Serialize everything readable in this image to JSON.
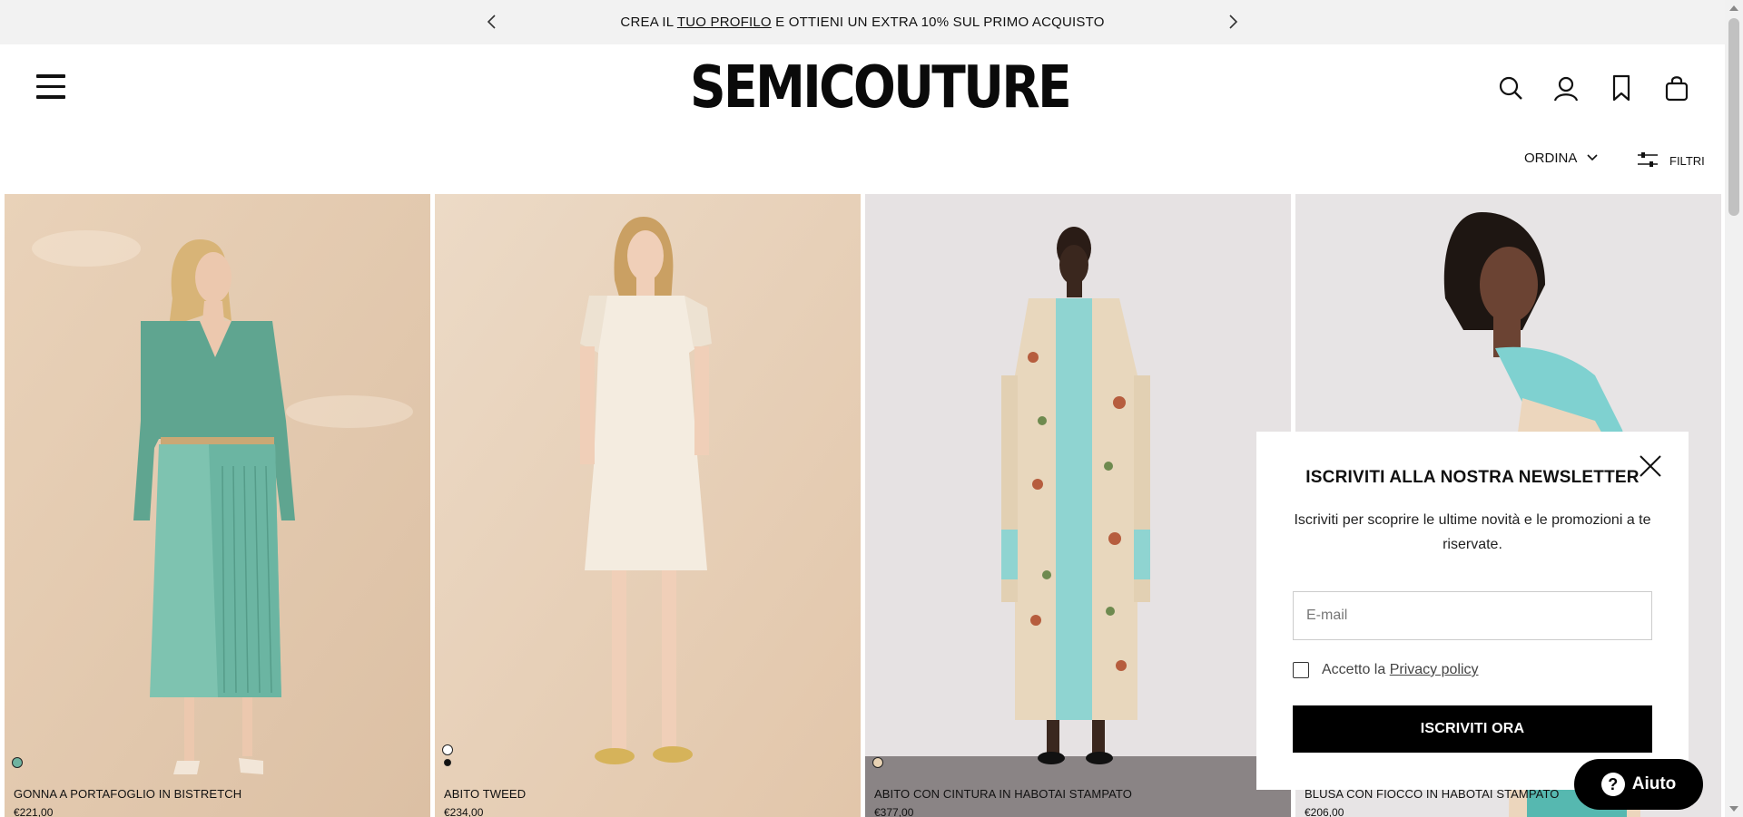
{
  "promo": {
    "text_before": "CREA IL ",
    "text_link": "TUO PROFILO",
    "text_after": " E OTTIENI UN EXTRA 10% SUL PRIMO ACQUISTO",
    "prev_icon": "chevron-left-icon",
    "next_icon": "chevron-right-icon"
  },
  "header": {
    "logo": "SEMICOUTURE",
    "menu_icon": "hamburger-menu-icon",
    "icons": [
      "search-icon",
      "account-icon",
      "bookmark-icon",
      "shopping-bag-icon"
    ]
  },
  "toolbar": {
    "sort_label": "ORDINA",
    "filters_label": "FILTRI"
  },
  "products": [
    {
      "name": "GONNA A PORTAFOGLIO IN BISTRETCH",
      "price": "€221,00",
      "swatches": [
        "#6fb3a0"
      ]
    },
    {
      "name": "ABITO TWEED",
      "price": "€234,00",
      "swatches": [
        "#ffffff",
        "#111111"
      ]
    },
    {
      "name": "ABITO CON CINTURA IN HABOTAI STAMPATO",
      "price": "€377,00",
      "swatches": [
        "#e9d3b4"
      ]
    },
    {
      "name": "BLUSA CON FIOCCO IN HABOTAI STAMPATO",
      "price": "€206,00",
      "swatches": []
    }
  ],
  "newsletter": {
    "title": "ISCRIVITI ALLA NOSTRA NEWSLETTER",
    "description": "Iscriviti per scoprire le ultime novità e le promozioni a te riservate.",
    "email_placeholder": "E-mail",
    "consent_text": "Accetto la ",
    "privacy_link": "Privacy policy",
    "button": "ISCRIVITI ORA",
    "close_icon": "close-icon"
  },
  "help": {
    "label": "Aiuto",
    "icon_glyph": "?"
  },
  "colors": {
    "promo_bg": "#f2f2f2",
    "primary": "#000000",
    "background": "#ffffff"
  }
}
